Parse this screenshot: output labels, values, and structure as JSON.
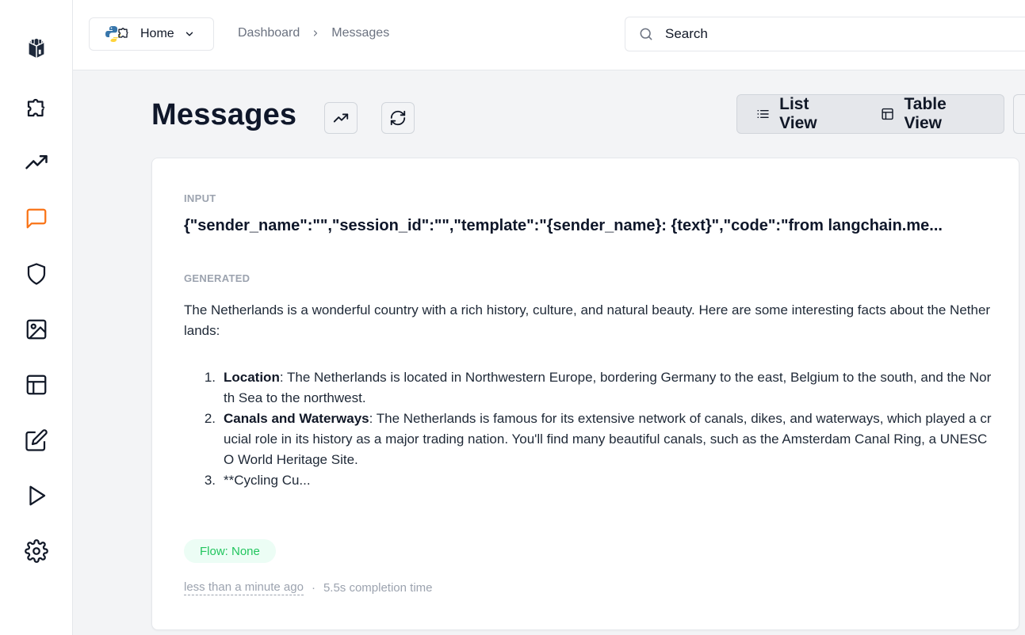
{
  "sidebar": {
    "items": [
      {
        "icon": "logo-icon",
        "label": "Home"
      },
      {
        "icon": "puzzle-icon",
        "label": "Plugins"
      },
      {
        "icon": "trending-up-icon",
        "label": "Analytics"
      },
      {
        "icon": "message-icon",
        "label": "Messages",
        "active": true
      },
      {
        "icon": "shield-icon",
        "label": "Security"
      },
      {
        "icon": "image-icon",
        "label": "Images"
      },
      {
        "icon": "table-icon",
        "label": "Tables"
      },
      {
        "icon": "edit-icon",
        "label": "Edit"
      },
      {
        "icon": "play-icon",
        "label": "Run"
      },
      {
        "icon": "gear-icon",
        "label": "Settings"
      }
    ],
    "active_color": "#f97316"
  },
  "header": {
    "home_label": "Home",
    "breadcrumb": [
      "Dashboard",
      "Messages"
    ],
    "search_placeholder": "Search"
  },
  "main": {
    "title": "Messages",
    "views": {
      "list": "List View",
      "table": "Table View"
    }
  },
  "card": {
    "input_label": "INPUT",
    "input_value": "{\"sender_name\":\"\",\"session_id\":\"\",\"template\":\"{sender_name}: {text}\",\"code\":\"from langchain.me...",
    "generated_label": "GENERATED",
    "generated_intro": "The Netherlands is a wonderful country with a rich history, culture, and natural beauty. Here are some interesting facts about the Netherlands:",
    "list": [
      {
        "num": "1.",
        "bold": "Location",
        "text": ": The Netherlands is located in Northwestern Europe, bordering Germany to the east, Belgium to the south, and the North Sea to the northwest."
      },
      {
        "num": "2.",
        "bold": "Canals and Waterways",
        "text": ": The Netherlands is famous for its extensive network of canals, dikes, and waterways, which played a crucial role in its history as a major trading nation. You'll find many beautiful canals, such as the Amsterdam Canal Ring, a UNESCO World Heritage Site."
      },
      {
        "num": "3.",
        "bold": "",
        "text": "**Cycling Cu..."
      }
    ],
    "flow_badge": "Flow: None",
    "timestamp": "less than a minute ago",
    "separator": "·",
    "completion": "5.5s completion time"
  }
}
